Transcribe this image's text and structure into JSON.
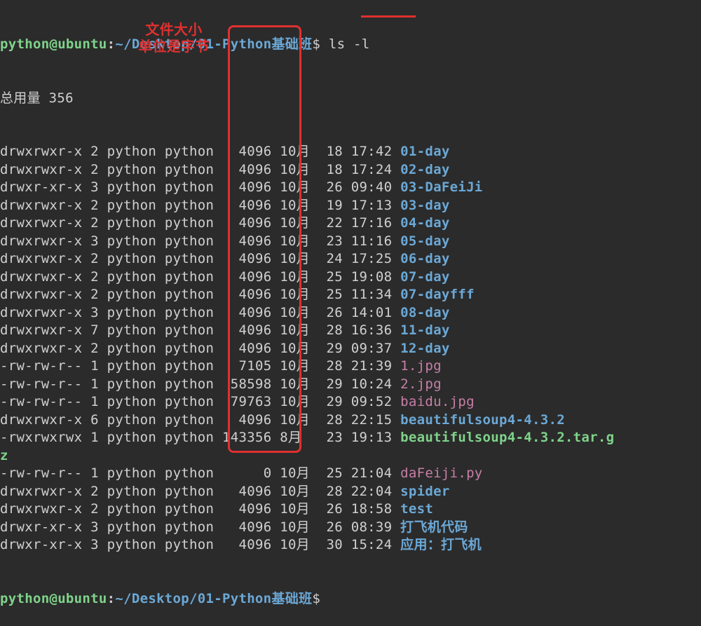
{
  "prompt": {
    "user": "python",
    "host": "ubuntu",
    "path": "~/Desktop/01-Python基础班",
    "dollar": "$"
  },
  "command": "ls -l",
  "total_label": "总用量 356",
  "annotation_line1": "文件大小",
  "annotation_line2": "单位是字节",
  "listing": [
    {
      "perms": "drwxrwxr-x",
      "links": "2",
      "owner": "python",
      "group": "python",
      "size": "4096",
      "mon": "10月",
      "day": "18",
      "time": "17:42",
      "name": "01-day",
      "type": "dir"
    },
    {
      "perms": "drwxrwxr-x",
      "links": "2",
      "owner": "python",
      "group": "python",
      "size": "4096",
      "mon": "10月",
      "day": "18",
      "time": "17:24",
      "name": "02-day",
      "type": "dir"
    },
    {
      "perms": "drwxr-xr-x",
      "links": "3",
      "owner": "python",
      "group": "python",
      "size": "4096",
      "mon": "10月",
      "day": "26",
      "time": "09:40",
      "name": "03-DaFeiJi",
      "type": "dir"
    },
    {
      "perms": "drwxrwxr-x",
      "links": "2",
      "owner": "python",
      "group": "python",
      "size": "4096",
      "mon": "10月",
      "day": "19",
      "time": "17:13",
      "name": "03-day",
      "type": "dir"
    },
    {
      "perms": "drwxrwxr-x",
      "links": "2",
      "owner": "python",
      "group": "python",
      "size": "4096",
      "mon": "10月",
      "day": "22",
      "time": "17:16",
      "name": "04-day",
      "type": "dir"
    },
    {
      "perms": "drwxrwxr-x",
      "links": "3",
      "owner": "python",
      "group": "python",
      "size": "4096",
      "mon": "10月",
      "day": "23",
      "time": "11:16",
      "name": "05-day",
      "type": "dir"
    },
    {
      "perms": "drwxrwxr-x",
      "links": "2",
      "owner": "python",
      "group": "python",
      "size": "4096",
      "mon": "10月",
      "day": "24",
      "time": "17:25",
      "name": "06-day",
      "type": "dir"
    },
    {
      "perms": "drwxrwxr-x",
      "links": "2",
      "owner": "python",
      "group": "python",
      "size": "4096",
      "mon": "10月",
      "day": "25",
      "time": "19:08",
      "name": "07-day",
      "type": "dir"
    },
    {
      "perms": "drwxrwxr-x",
      "links": "2",
      "owner": "python",
      "group": "python",
      "size": "4096",
      "mon": "10月",
      "day": "25",
      "time": "11:34",
      "name": "07-dayfff",
      "type": "dir"
    },
    {
      "perms": "drwxrwxr-x",
      "links": "3",
      "owner": "python",
      "group": "python",
      "size": "4096",
      "mon": "10月",
      "day": "26",
      "time": "14:01",
      "name": "08-day",
      "type": "dir"
    },
    {
      "perms": "drwxrwxr-x",
      "links": "7",
      "owner": "python",
      "group": "python",
      "size": "4096",
      "mon": "10月",
      "day": "28",
      "time": "16:36",
      "name": "11-day",
      "type": "dir"
    },
    {
      "perms": "drwxrwxr-x",
      "links": "2",
      "owner": "python",
      "group": "python",
      "size": "4096",
      "mon": "10月",
      "day": "29",
      "time": "09:37",
      "name": "12-day",
      "type": "dir"
    },
    {
      "perms": "-rw-rw-r--",
      "links": "1",
      "owner": "python",
      "group": "python",
      "size": "7105",
      "mon": "10月",
      "day": "28",
      "time": "21:39",
      "name": "1.jpg",
      "type": "file"
    },
    {
      "perms": "-rw-rw-r--",
      "links": "1",
      "owner": "python",
      "group": "python",
      "size": "58598",
      "mon": "10月",
      "day": "29",
      "time": "10:24",
      "name": "2.jpg",
      "type": "file"
    },
    {
      "perms": "-rw-rw-r--",
      "links": "1",
      "owner": "python",
      "group": "python",
      "size": "79763",
      "mon": "10月",
      "day": "29",
      "time": "09:52",
      "name": "baidu.jpg",
      "type": "file"
    },
    {
      "perms": "drwxrwxr-x",
      "links": "6",
      "owner": "python",
      "group": "python",
      "size": "4096",
      "mon": "10月",
      "day": "28",
      "time": "22:15",
      "name": "beautifulsoup4-4.3.2",
      "type": "dir"
    },
    {
      "perms": "-rwxrwxrwx",
      "links": "1",
      "owner": "python",
      "group": "python",
      "size": "143356",
      "mon": "8月 ",
      "day": "23",
      "time": "19:13",
      "name": "beautifulsoup4-4.3.2.tar.g",
      "type": "exec",
      "wrap": "z"
    },
    {
      "perms": "-rw-rw-r--",
      "links": "1",
      "owner": "python",
      "group": "python",
      "size": "0",
      "mon": "10月",
      "day": "25",
      "time": "21:04",
      "name": "daFeiji.py",
      "type": "file"
    },
    {
      "perms": "drwxrwxr-x",
      "links": "2",
      "owner": "python",
      "group": "python",
      "size": "4096",
      "mon": "10月",
      "day": "28",
      "time": "22:04",
      "name": "spider",
      "type": "dir"
    },
    {
      "perms": "drwxrwxr-x",
      "links": "2",
      "owner": "python",
      "group": "python",
      "size": "4096",
      "mon": "10月",
      "day": "26",
      "time": "18:58",
      "name": "test",
      "type": "dir"
    },
    {
      "perms": "drwxr-xr-x",
      "links": "3",
      "owner": "python",
      "group": "python",
      "size": "4096",
      "mon": "10月",
      "day": "26",
      "time": "08:39",
      "name": "打飞机代码",
      "type": "dir"
    },
    {
      "perms": "drwxr-xr-x",
      "links": "3",
      "owner": "python",
      "group": "python",
      "size": "4096",
      "mon": "10月",
      "day": "30",
      "time": "15:24",
      "name": "应用：打飞机",
      "type": "dir"
    }
  ]
}
